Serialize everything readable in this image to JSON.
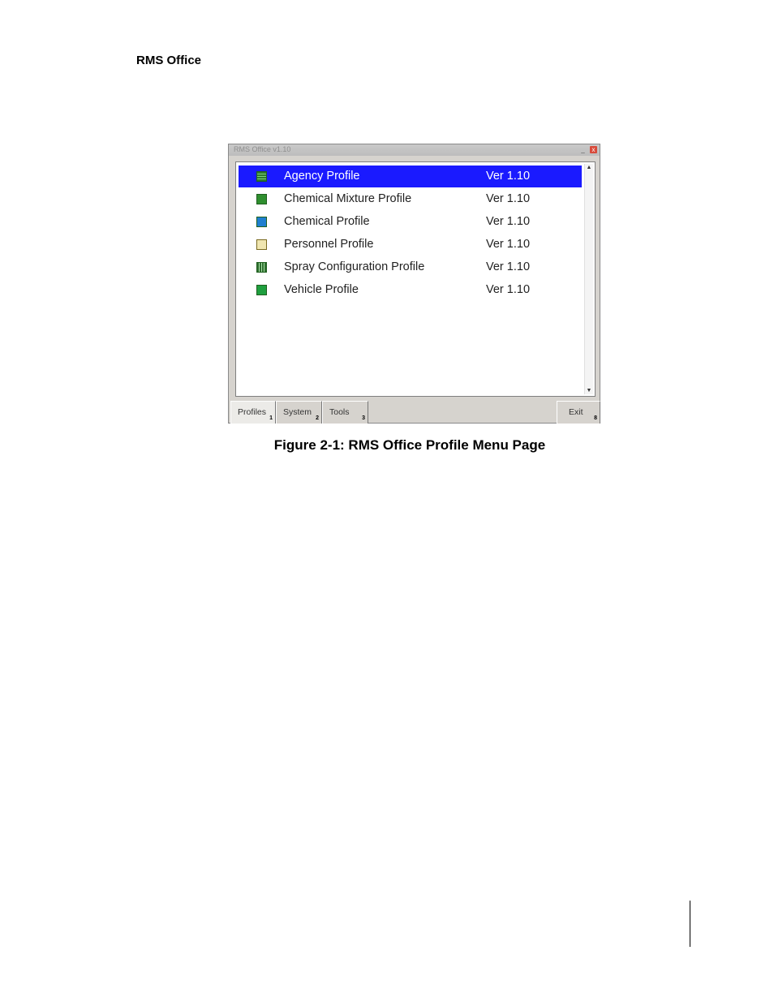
{
  "document": {
    "header": "RMS Office",
    "caption": "Figure 2-1: RMS Office Profile Menu Page"
  },
  "window": {
    "title": "RMS Office v1.10",
    "minimize_symbol": "_",
    "close_symbol": "x",
    "items": [
      {
        "label": "Agency Profile",
        "version": "Ver 1.10",
        "icon": "agency-icon",
        "selected": true
      },
      {
        "label": "Chemical Mixture Profile",
        "version": "Ver 1.10",
        "icon": "chemical-mixture-icon",
        "selected": false
      },
      {
        "label": "Chemical Profile",
        "version": "Ver 1.10",
        "icon": "chemical-icon",
        "selected": false
      },
      {
        "label": "Personnel Profile",
        "version": "Ver 1.10",
        "icon": "personnel-icon",
        "selected": false
      },
      {
        "label": "Spray Configuration Profile",
        "version": "Ver 1.10",
        "icon": "spray-configuration-icon",
        "selected": false
      },
      {
        "label": "Vehicle Profile",
        "version": "Ver 1.10",
        "icon": "vehicle-icon",
        "selected": false
      }
    ],
    "scroll_up_symbol": "▲",
    "scroll_down_symbol": "▼",
    "tabs": [
      {
        "label": "Profiles",
        "number": "1",
        "active": true
      },
      {
        "label": "System",
        "number": "2",
        "active": false
      },
      {
        "label": "Tools",
        "number": "3",
        "active": false
      }
    ],
    "exit": {
      "label": "Exit",
      "number": "8"
    }
  },
  "colors": {
    "selection": "#1a1aff",
    "window_chrome": "#d6d3ce"
  }
}
